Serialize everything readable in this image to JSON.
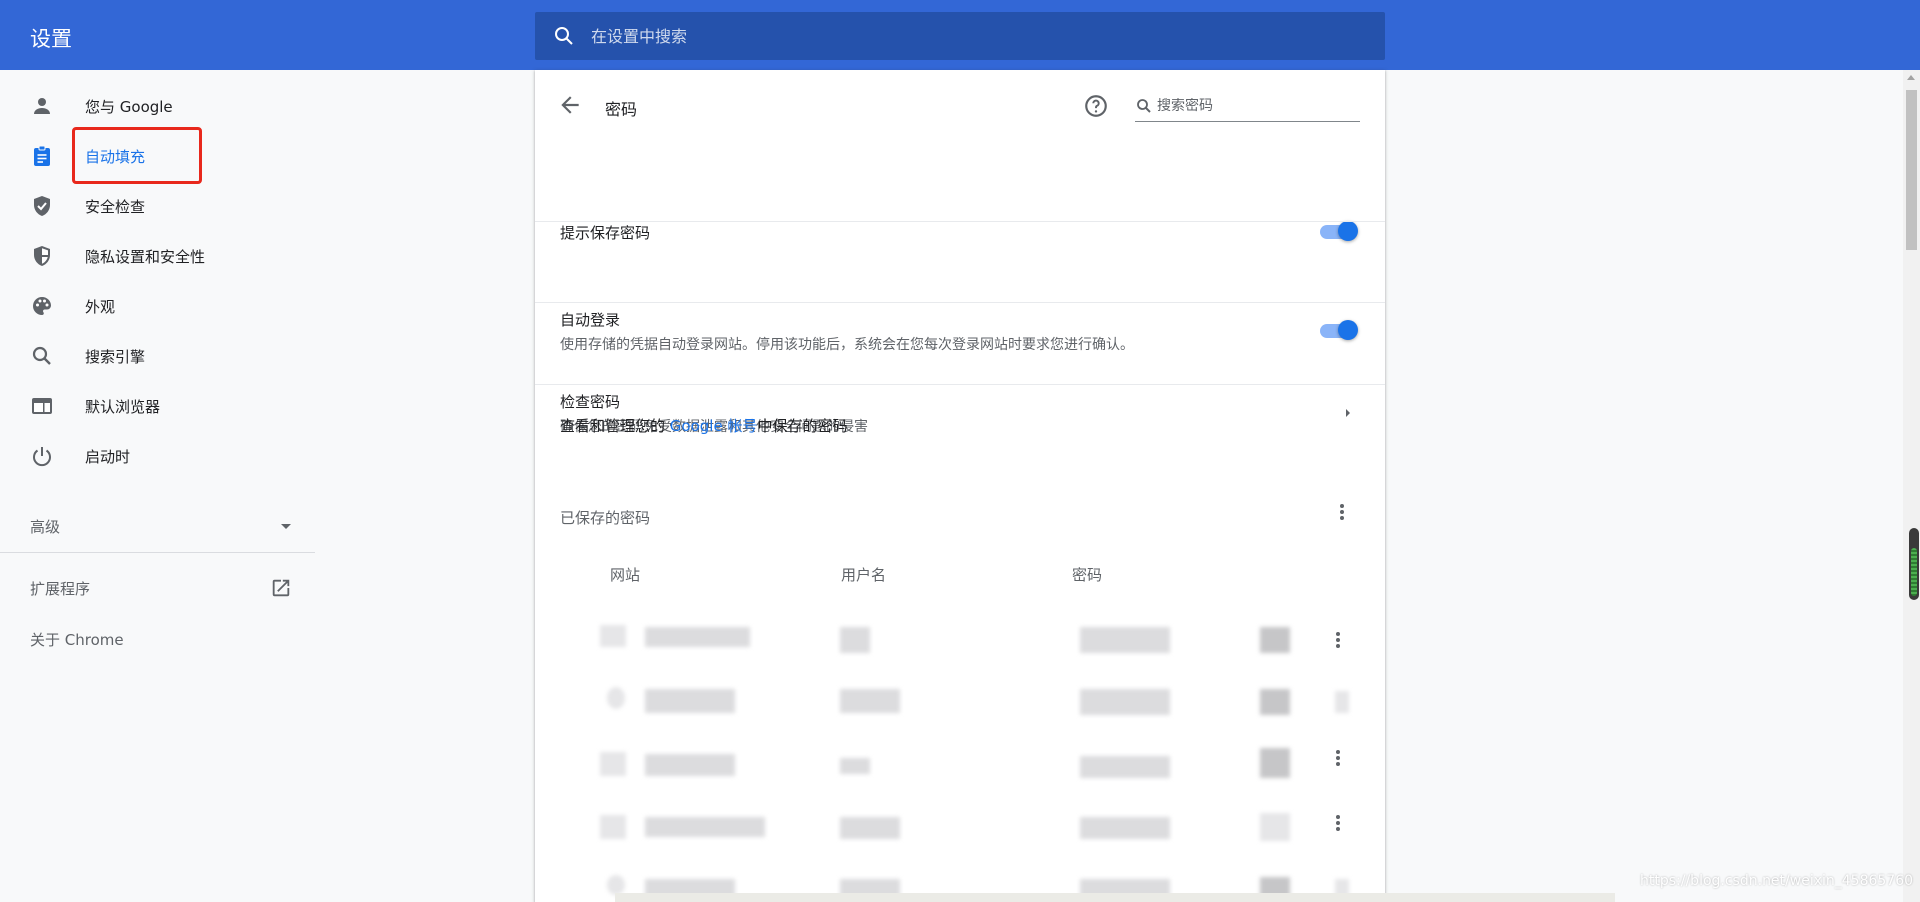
{
  "header": {
    "title": "设置",
    "search_placeholder": "在设置中搜索"
  },
  "sidebar": {
    "items": [
      {
        "label": "您与 Google",
        "icon": "person-icon"
      },
      {
        "label": "自动填充",
        "icon": "clipboard-icon",
        "active": true
      },
      {
        "label": "安全检查",
        "icon": "shield-check-icon"
      },
      {
        "label": "隐私设置和安全性",
        "icon": "shield-half-icon"
      },
      {
        "label": "外观",
        "icon": "palette-icon"
      },
      {
        "label": "搜索引擎",
        "icon": "search-icon"
      },
      {
        "label": "默认浏览器",
        "icon": "browser-icon"
      },
      {
        "label": "启动时",
        "icon": "power-icon"
      }
    ],
    "advanced_label": "高级",
    "extensions_label": "扩展程序",
    "about_label": "关于 Chrome"
  },
  "passwords": {
    "title": "密码",
    "search_placeholder": "搜索密码",
    "offer_to_save": {
      "label": "提示保存密码",
      "enabled": true
    },
    "auto_signin": {
      "label": "自动登录",
      "description": "使用存储的凭据自动登录网站。停用该功能后，系统会在您每次登录网站时要求您进行确认。",
      "enabled": true
    },
    "check_passwords": {
      "label": "检查密码",
      "description": "确保您的密码免受数据泄露和其他安全问题的侵害"
    },
    "manage": {
      "prefix": "查看和管理您的 ",
      "link": "Google 帐号",
      "suffix": "中保存的密码"
    },
    "saved_header": "已保存的密码",
    "columns": [
      "网站",
      "用户名",
      "密码"
    ]
  },
  "watermark": "https://blog.csdn.net/weixin_45865760",
  "colors": {
    "header_bg": "#3367d6",
    "accent": "#1a73e8",
    "highlight": "#e8281c"
  }
}
